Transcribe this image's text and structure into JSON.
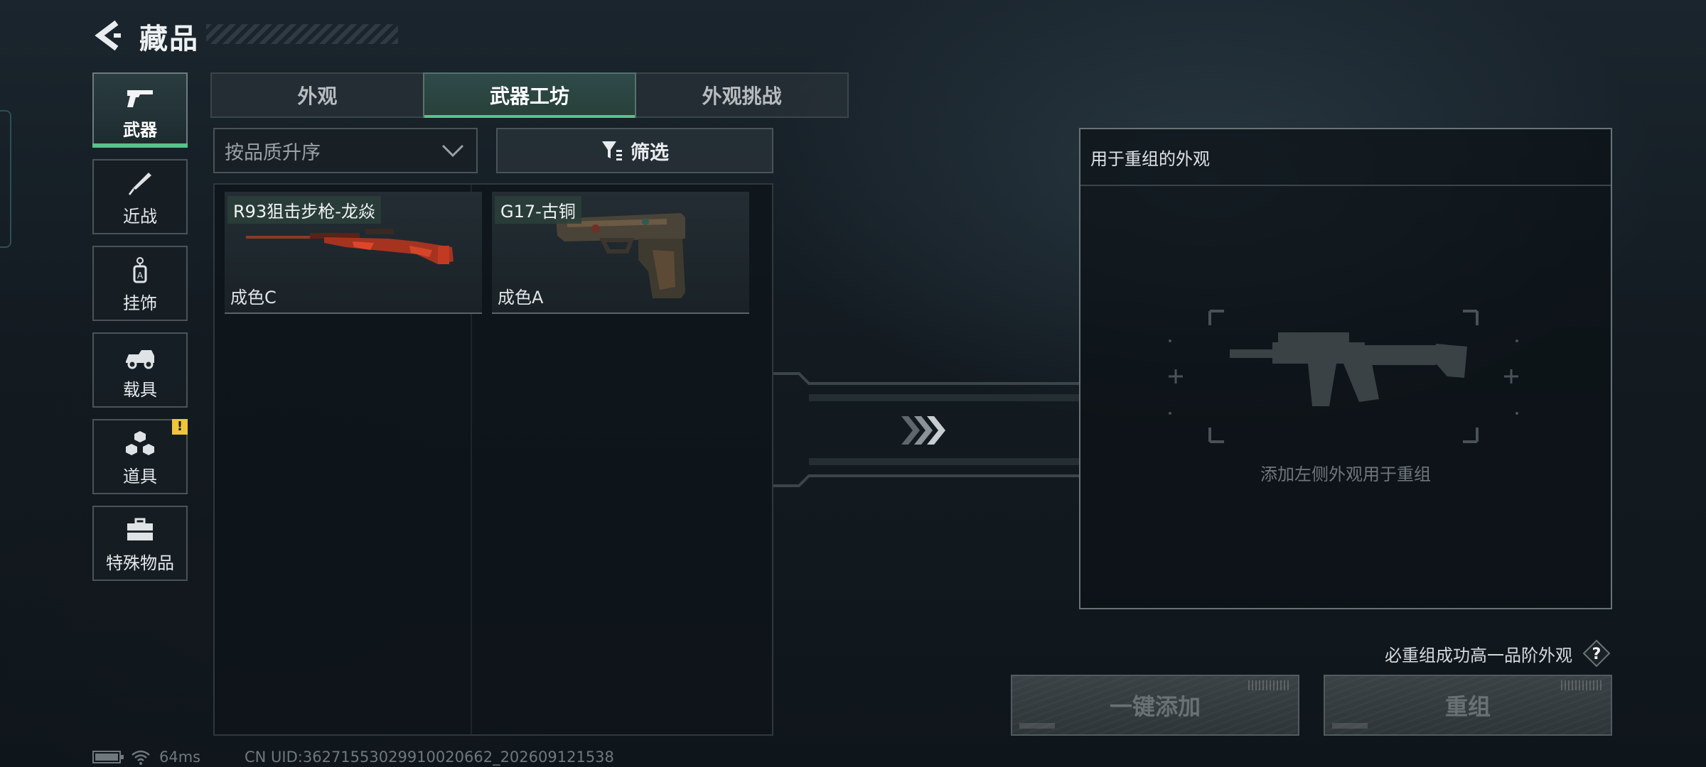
{
  "header": {
    "title": "藏品",
    "back_icon": "chevron-left-icon"
  },
  "sidebar": {
    "items": [
      {
        "label": "武器",
        "icon": "pistol-icon",
        "active": true
      },
      {
        "label": "近战",
        "icon": "knife-icon",
        "active": false
      },
      {
        "label": "挂饰",
        "icon": "charm-icon",
        "active": false
      },
      {
        "label": "载具",
        "icon": "vehicle-icon",
        "active": false
      },
      {
        "label": "道具",
        "icon": "cubes-icon",
        "active": false,
        "badge": "!"
      },
      {
        "label": "特殊物品",
        "icon": "toolbox-icon",
        "active": false
      }
    ]
  },
  "tabs": [
    {
      "label": "外观",
      "active": false
    },
    {
      "label": "武器工坊",
      "active": true
    },
    {
      "label": "外观挑战",
      "active": false
    }
  ],
  "sort": {
    "label": "按品质升序"
  },
  "filter": {
    "label": "筛选"
  },
  "items": [
    {
      "name": "R93狙击步枪-龙焱",
      "grade": "成色C",
      "icon": "sniper-rifle-icon"
    },
    {
      "name": "G17-古铜",
      "grade": "成色A",
      "icon": "pistol-icon"
    }
  ],
  "recombine": {
    "title": "用于重组的外观",
    "placeholder": "添加左侧外观用于重组"
  },
  "hint": "必重组成功高一品阶外观",
  "buttons": {
    "add_all": "一键添加",
    "recombine": "重组"
  },
  "status": {
    "ping": "64ms",
    "uid": "CN UID:36271553029910020662_202609121538"
  },
  "colors": {
    "accent_green": "#57c48a",
    "badge_yellow": "#f0c53a"
  }
}
